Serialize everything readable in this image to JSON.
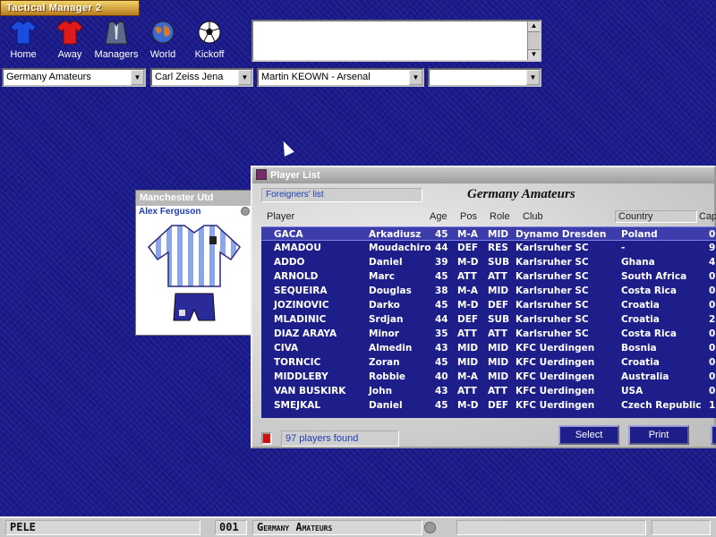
{
  "app": {
    "title": "Tactical Manager 2"
  },
  "nav": [
    {
      "label": "Home",
      "icon": "home-shirt-icon",
      "color": "#1a4ce0"
    },
    {
      "label": "Away",
      "icon": "away-shirt-icon",
      "color": "#e01a1a"
    },
    {
      "label": "Managers",
      "icon": "managers-suit-icon",
      "color": "#5a6a8a"
    },
    {
      "label": "World",
      "icon": "world-globe-icon",
      "color": "#d07a30"
    },
    {
      "label": "Kickoff",
      "icon": "football-icon",
      "color": "#ffffff"
    }
  ],
  "selectors": {
    "league": "Germany Amateurs",
    "club": "Carl Zeiss Jena",
    "player": "Martin KEOWN  -  Arsenal",
    "extra": ""
  },
  "manager_panel": {
    "team": "Manchester Utd",
    "manager": "Alex Ferguson"
  },
  "player_list": {
    "window_title": "Player List",
    "filter_tag": "Foreigners' list",
    "heading": "Germany Amateurs",
    "columns": {
      "player": "Player",
      "age": "Age",
      "pos": "Pos",
      "role": "Role",
      "club": "Club",
      "country": "Country",
      "caps": "Caps"
    },
    "rows": [
      {
        "surname": "GACA",
        "first": "Arkadiusz",
        "age": "45",
        "pos": "M-A",
        "role": "MID",
        "club": "Dynamo Dresden",
        "country": "Poland",
        "caps": "0"
      },
      {
        "surname": "AMADOU",
        "first": "Moudachiro",
        "age": "44",
        "pos": "DEF",
        "role": "RES",
        "club": "Karlsruher SC",
        "country": "-",
        "caps": "9"
      },
      {
        "surname": "ADDO",
        "first": "Daniel",
        "age": "39",
        "pos": "M-D",
        "role": "SUB",
        "club": "Karlsruher SC",
        "country": "Ghana",
        "caps": "4"
      },
      {
        "surname": "ARNOLD",
        "first": "Marc",
        "age": "45",
        "pos": "ATT",
        "role": "ATT",
        "club": "Karlsruher SC",
        "country": "South Africa",
        "caps": "0"
      },
      {
        "surname": "SEQUEIRA",
        "first": "Douglas",
        "age": "38",
        "pos": "M-A",
        "role": "MID",
        "club": "Karlsruher SC",
        "country": "Costa Rica",
        "caps": "0"
      },
      {
        "surname": "JOZINOVIC",
        "first": "Darko",
        "age": "45",
        "pos": "M-D",
        "role": "DEF",
        "club": "Karlsruher SC",
        "country": "Croatia",
        "caps": "0"
      },
      {
        "surname": "MLADINIC",
        "first": "Srdjan",
        "age": "44",
        "pos": "DEF",
        "role": "SUB",
        "club": "Karlsruher SC",
        "country": "Croatia",
        "caps": "2"
      },
      {
        "surname": "DIAZ ARAYA",
        "first": "Minor",
        "age": "35",
        "pos": "ATT",
        "role": "ATT",
        "club": "Karlsruher SC",
        "country": "Costa Rica",
        "caps": "0"
      },
      {
        "surname": "CIVA",
        "first": "Almedin",
        "age": "43",
        "pos": "MID",
        "role": "MID",
        "club": "KFC Uerdingen",
        "country": "Bosnia",
        "caps": "0"
      },
      {
        "surname": "TORNCIC",
        "first": "Zoran",
        "age": "45",
        "pos": "MID",
        "role": "MID",
        "club": "KFC Uerdingen",
        "country": "Croatia",
        "caps": "0"
      },
      {
        "surname": "MIDDLEBY",
        "first": "Robbie",
        "age": "40",
        "pos": "M-A",
        "role": "MID",
        "club": "KFC Uerdingen",
        "country": "Australia",
        "caps": "0"
      },
      {
        "surname": "VAN BUSKIRK",
        "first": "John",
        "age": "43",
        "pos": "ATT",
        "role": "ATT",
        "club": "KFC Uerdingen",
        "country": "USA",
        "caps": "0"
      },
      {
        "surname": "SMEJKAL",
        "first": "Daniel",
        "age": "45",
        "pos": "M-D",
        "role": "DEF",
        "club": "KFC Uerdingen",
        "country": "Czech Republic",
        "caps": "1"
      }
    ],
    "found_text": "97 players found",
    "select_label": "Select",
    "print_label": "Print"
  },
  "status_bar": {
    "player": "PELE",
    "number": "001",
    "league": "Germany Amateurs"
  }
}
